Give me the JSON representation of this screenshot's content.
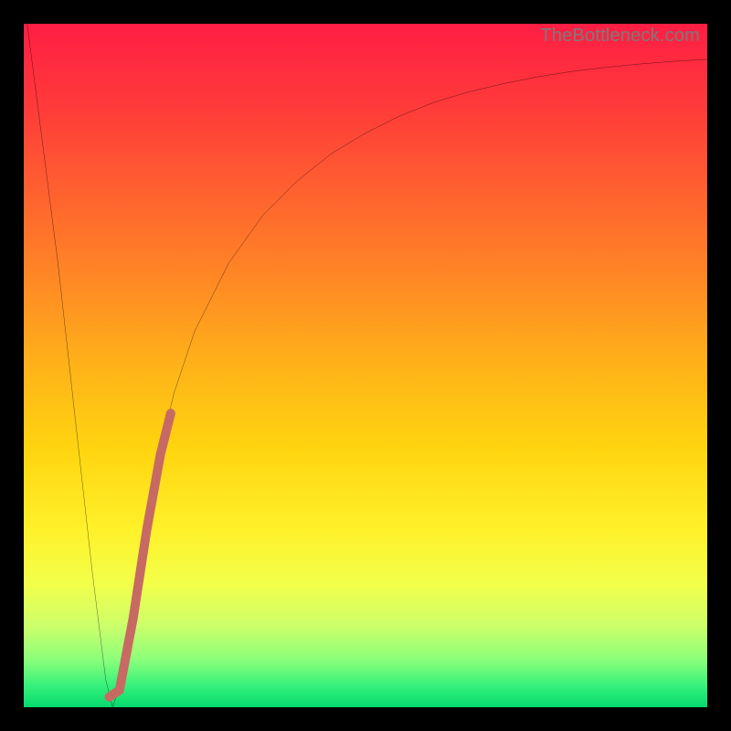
{
  "watermark": "TheBottleneck.com",
  "chart_data": {
    "type": "line",
    "title": "",
    "xlabel": "",
    "ylabel": "",
    "xlim": [
      0,
      100
    ],
    "ylim": [
      0,
      100
    ],
    "grid": false,
    "legend": false,
    "gradient_stops": [
      {
        "pos": 0.0,
        "color": "#ff1e44"
      },
      {
        "pos": 0.12,
        "color": "#ff3a3a"
      },
      {
        "pos": 0.25,
        "color": "#ff622f"
      },
      {
        "pos": 0.38,
        "color": "#ff8a24"
      },
      {
        "pos": 0.5,
        "color": "#ffb219"
      },
      {
        "pos": 0.62,
        "color": "#ffd40f"
      },
      {
        "pos": 0.74,
        "color": "#fff12a"
      },
      {
        "pos": 0.82,
        "color": "#f2ff4a"
      },
      {
        "pos": 0.88,
        "color": "#cdff6a"
      },
      {
        "pos": 0.93,
        "color": "#8cff7a"
      },
      {
        "pos": 0.97,
        "color": "#33f07a"
      },
      {
        "pos": 1.0,
        "color": "#06d96e"
      }
    ],
    "series": [
      {
        "name": "bottleneck-curve",
        "stroke": "#000000",
        "stroke_width": 2,
        "x": [
          0.5,
          5,
          10,
          12,
          13,
          14,
          15,
          16,
          18,
          20,
          22,
          25,
          30,
          35,
          40,
          45,
          50,
          55,
          60,
          65,
          70,
          75,
          80,
          85,
          90,
          95,
          100
        ],
        "y": [
          100,
          65,
          20,
          4,
          0,
          3,
          9,
          16,
          28,
          38,
          46,
          55,
          65,
          72,
          77,
          81,
          84,
          86.5,
          88.5,
          90,
          91.2,
          92.2,
          93,
          93.6,
          94.1,
          94.5,
          94.8
        ]
      },
      {
        "name": "highlight-segment",
        "stroke": "#c76a63",
        "stroke_width": 10,
        "linecap": "round",
        "x": [
          12.5,
          14,
          16,
          18,
          20,
          21.5
        ],
        "y": [
          1.5,
          2.5,
          13,
          26,
          37,
          43
        ]
      }
    ]
  }
}
